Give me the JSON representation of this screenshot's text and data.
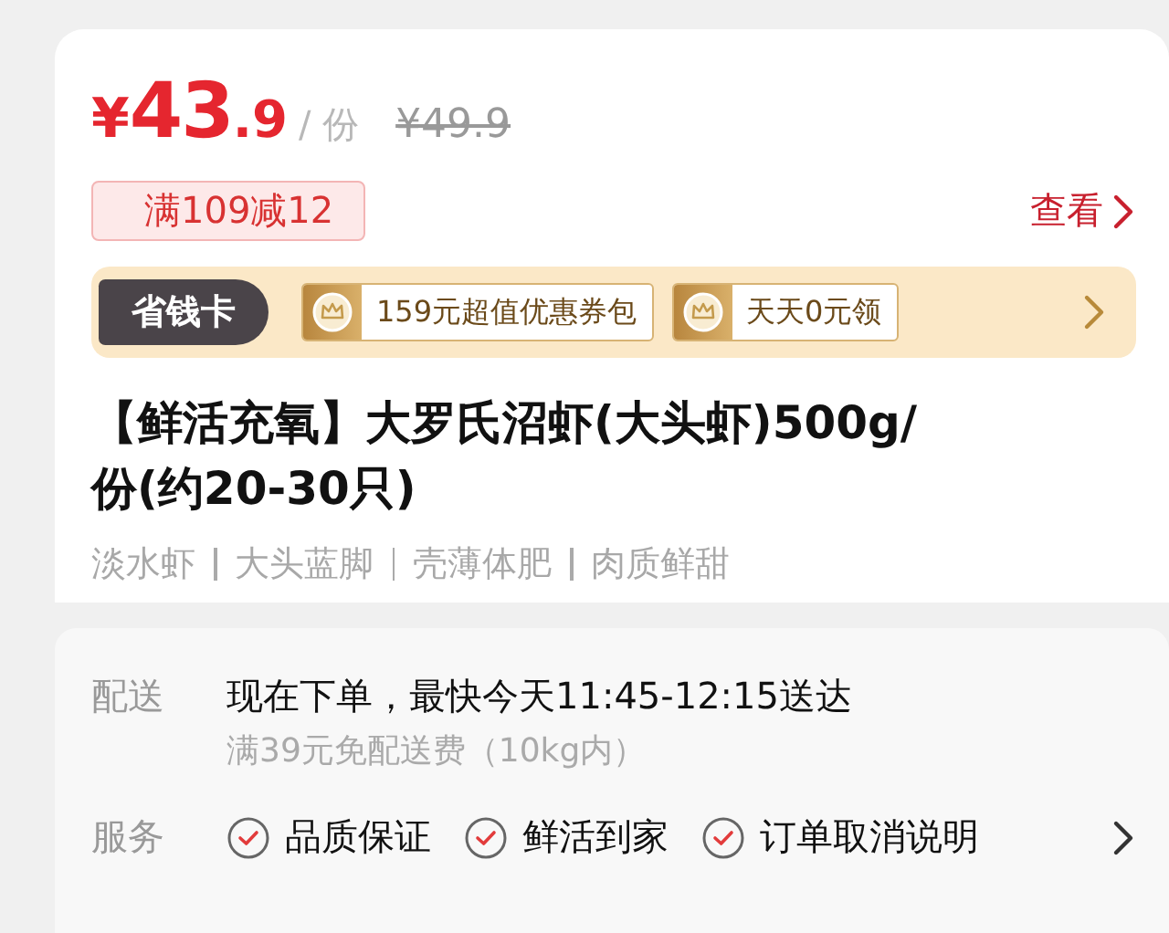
{
  "price": {
    "currency": "¥",
    "integer": "43",
    "decimal": ".9",
    "unit": "/ 份",
    "original": "¥49.9"
  },
  "coupon": {
    "label": "满109减12",
    "link": "查看"
  },
  "savings_card": {
    "badge": "省钱卡",
    "offers": [
      "159元超值优惠券包",
      "天天0元领"
    ]
  },
  "title": "【鲜活充氧】大罗氏沼虾(大头虾)500g/份(约20-30只)",
  "tags": [
    "淡水虾",
    "大头蓝脚",
    "壳薄体肥",
    "肉质鲜甜"
  ],
  "delivery": {
    "label": "配送",
    "main": "现在下单，最快今天11:45-12:15送达",
    "note": "满39元免配送费（10kg内）"
  },
  "services": {
    "label": "服务",
    "items": [
      "品质保证",
      "鲜活到家",
      "订单取消说明"
    ]
  }
}
